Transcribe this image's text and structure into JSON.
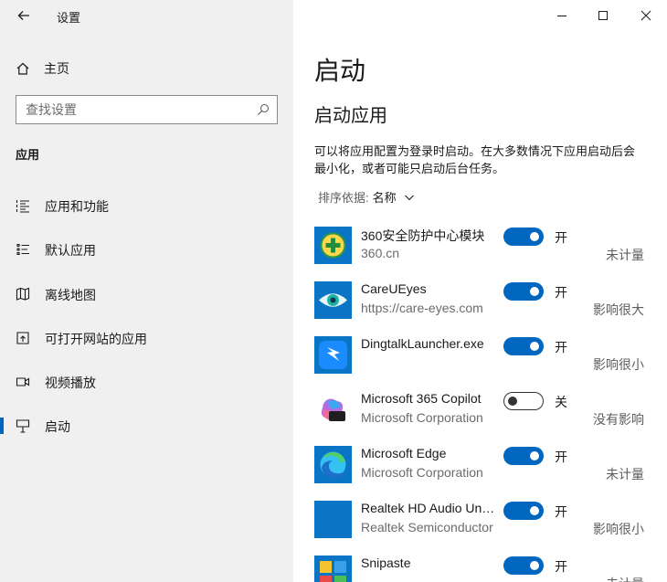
{
  "window": {
    "title": "设置"
  },
  "nav": {
    "home_label": "主页",
    "search_placeholder": "查找设置",
    "section_title": "应用",
    "items": [
      {
        "label": "应用和功能",
        "icon": "apps-list-icon"
      },
      {
        "label": "默认应用",
        "icon": "default-apps-icon"
      },
      {
        "label": "离线地图",
        "icon": "map-icon"
      },
      {
        "label": "可打开网站的应用",
        "icon": "open-web-icon"
      },
      {
        "label": "视频播放",
        "icon": "video-icon"
      },
      {
        "label": "启动",
        "icon": "startup-icon",
        "selected": true
      }
    ]
  },
  "content": {
    "title": "启动",
    "subtitle": "启动应用",
    "description": "可以将应用配置为登录时启动。在大多数情况下应用启动后会最小化，或者可能只启动后台任务。",
    "sort_label": "排序依据:",
    "sort_value": "名称",
    "apps": [
      {
        "name": "360安全防护中心模块",
        "publisher": "360.cn",
        "enabled": true,
        "state_label": "开",
        "impact": "未计量"
      },
      {
        "name": "CareUEyes",
        "publisher": "https://care-eyes.com",
        "enabled": true,
        "state_label": "开",
        "impact": "影响很大"
      },
      {
        "name": "DingtalkLauncher.exe",
        "publisher": "",
        "enabled": true,
        "state_label": "开",
        "impact": "影响很小"
      },
      {
        "name": "Microsoft 365 Copilot",
        "publisher": "Microsoft Corporation",
        "enabled": false,
        "state_label": "关",
        "impact": "没有影响"
      },
      {
        "name": "Microsoft Edge",
        "publisher": "Microsoft Corporation",
        "enabled": true,
        "state_label": "开",
        "impact": "未计量"
      },
      {
        "name": "Realtek HD Audio Universal Service",
        "publisher": "Realtek Semiconductor",
        "enabled": true,
        "state_label": "开",
        "impact": "影响很小"
      },
      {
        "name": "Snipaste",
        "publisher": "",
        "enabled": true,
        "state_label": "开",
        "impact": "未计量"
      }
    ]
  },
  "colors": {
    "accent": "#0067c0",
    "nav_background": "#f0f0f0"
  }
}
